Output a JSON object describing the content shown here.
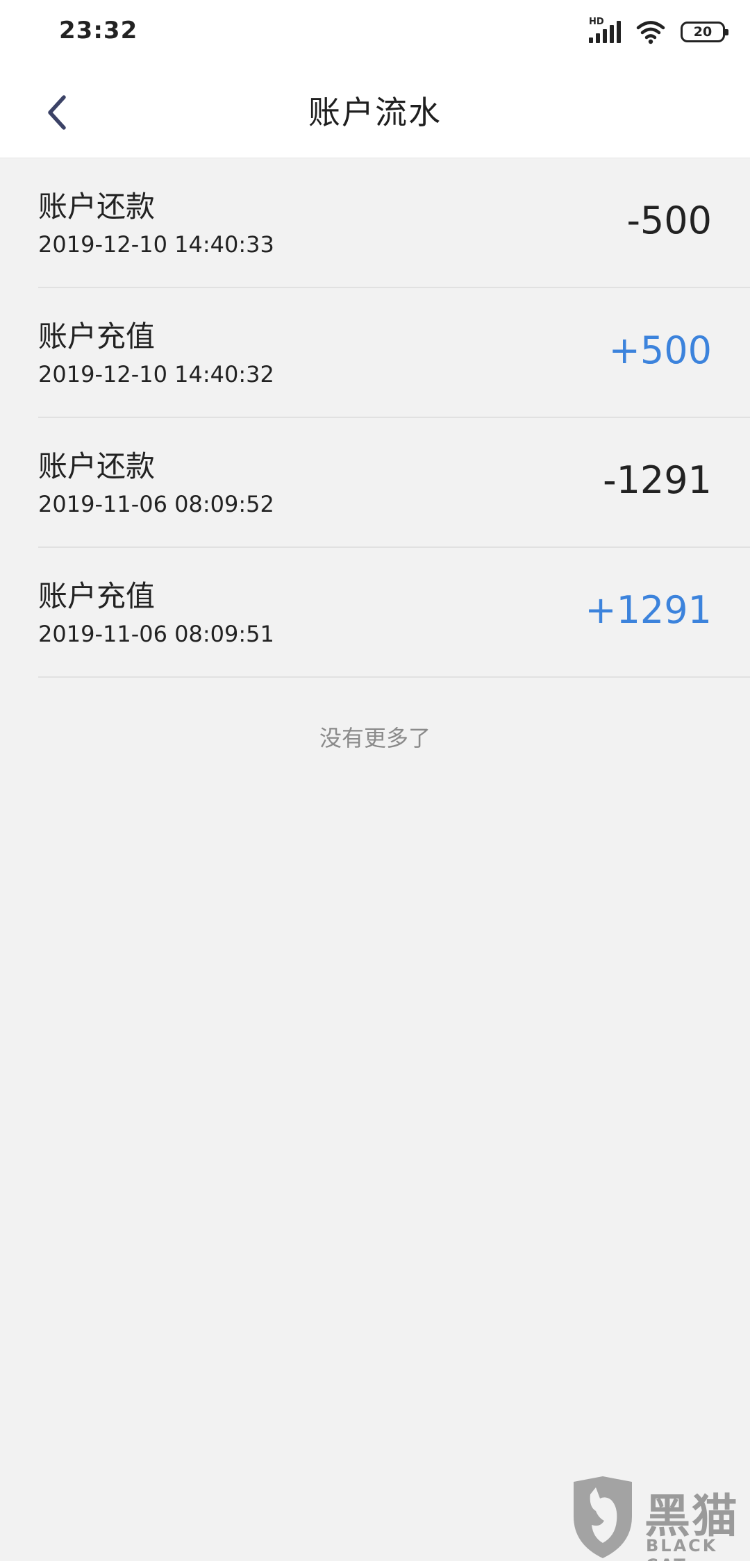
{
  "status_bar": {
    "time": "23:32",
    "signal_label": "HD",
    "battery_level": "20"
  },
  "header": {
    "title": "账户流水",
    "back_icon": "chevron-left-icon"
  },
  "transactions": [
    {
      "title": "账户还款",
      "time": "2019-12-10 14:40:33",
      "amount": "-500",
      "type": "debit"
    },
    {
      "title": "账户充值",
      "time": "2019-12-10 14:40:32",
      "amount": "+500",
      "type": "credit"
    },
    {
      "title": "账户还款",
      "time": "2019-11-06 08:09:52",
      "amount": "-1291",
      "type": "debit"
    },
    {
      "title": "账户充值",
      "time": "2019-11-06 08:09:51",
      "amount": "+1291",
      "type": "credit"
    }
  ],
  "footer": {
    "no_more_text": "没有更多了"
  },
  "watermark": {
    "cn": "黑猫",
    "en": "BLACK CAT"
  },
  "colors": {
    "credit": "#3c83dc",
    "debit": "#222222",
    "background": "#f2f2f2",
    "header_bg": "#ffffff"
  }
}
